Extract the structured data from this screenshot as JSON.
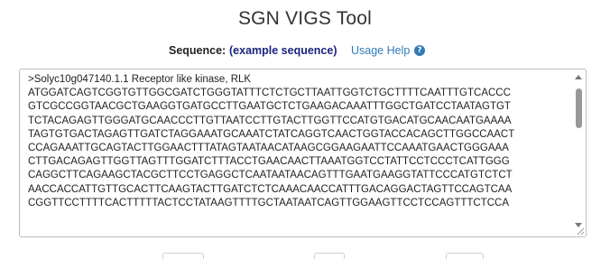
{
  "header": {
    "title": "SGN VIGS Tool"
  },
  "sequence": {
    "label": "Sequence:",
    "example_link": "(example sequence)",
    "help_link": "Usage Help",
    "help_icon": "question-circle-icon",
    "text": ">Solyc10g047140.1.1 Receptor like kinase, RLK\nATGGATCAGTCGGTGTTGGCGATCTGGGTATTTCTCTGCTTAATTGGTCTGCTTTTCAATTTGTCACCC\nGTCGCCGGTAACGCTGAAGGTGATGCCTTGAATGCTCTGAAGACAAATTTGGCTGATCCTAATAGTGT\nTCTACAGAGTTGGGATGCAACCCTTGTTAATCCTTGTACTTGGTTCCATGTGACATGCAACAATGAAAA\nTAGTGTGACTAGAGTTGATCTAGGAAATGCAAATCTATCAGGTCAACTGGTACCACAGCTTGGCCAACT\nCCAGAAATTGCAGTACTTGGAACTTTATAGTAATAACATAAGCGGAAGAATTCCAAATGAACTGGGAAA\nCTTGACAGAGTTGGTTAGTTTGGATCTTTACCTGAACAACTTAAATGGTCCTATTCCTCCCTCATTGGG\nCAGGCTTCAGAAGCTACGCTTCCTGAGGCTCAATAATAACAGTTTGAATGAAGGTATTCCCATGTCTCT\nAACCACCATTGTTGCACTTCAAGTACTTGATCTCTCAAACAACCATTTGACAGGACTAGTTCCAGTCAA\nCGGTTCCTTTTCACTTTTTACTCCTATAAGTTTTGCTAATAATCAGTTGGAAGTTCCTCCAGTTTCTCCA"
  },
  "colors": {
    "link": "#337ab7",
    "example_link": "#1a237e",
    "text": "#222222",
    "border": "#bdbdbd"
  }
}
